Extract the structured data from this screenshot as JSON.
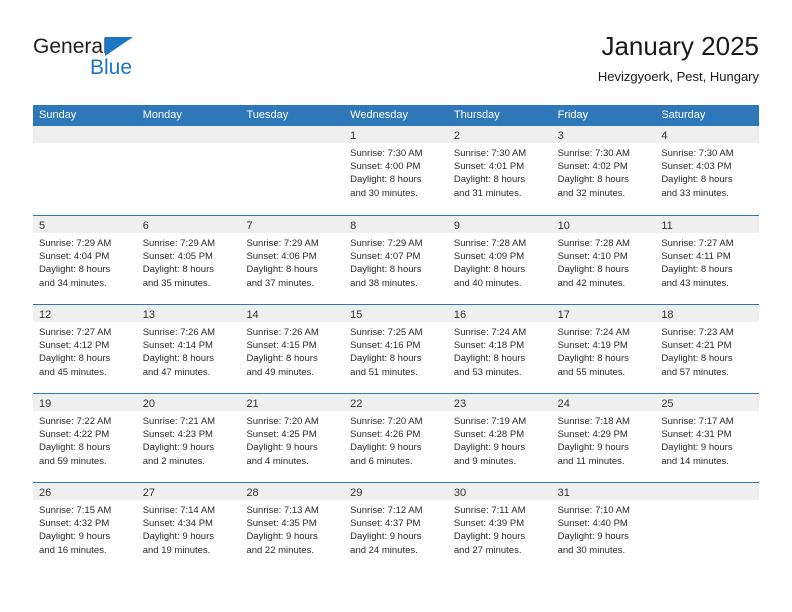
{
  "brand": {
    "line1": "General",
    "line2": "Blue",
    "triangle_color": "#1b77c4"
  },
  "header": {
    "title": "January 2025",
    "subtitle": "Hevizgyoerk, Pest, Hungary"
  },
  "theme": {
    "header_blue": "#2e77b8",
    "day_bar_gray": "#efefef",
    "text": "#2a2a2a"
  },
  "weekdays": [
    "Sunday",
    "Monday",
    "Tuesday",
    "Wednesday",
    "Thursday",
    "Friday",
    "Saturday"
  ],
  "weeks": [
    [
      {
        "day": "",
        "sunrise": "",
        "sunset": "",
        "daylight_line1": "",
        "daylight_line2": ""
      },
      {
        "day": "",
        "sunrise": "",
        "sunset": "",
        "daylight_line1": "",
        "daylight_line2": ""
      },
      {
        "day": "",
        "sunrise": "",
        "sunset": "",
        "daylight_line1": "",
        "daylight_line2": ""
      },
      {
        "day": "1",
        "sunrise": "Sunrise: 7:30 AM",
        "sunset": "Sunset: 4:00 PM",
        "daylight_line1": "Daylight: 8 hours",
        "daylight_line2": "and 30 minutes."
      },
      {
        "day": "2",
        "sunrise": "Sunrise: 7:30 AM",
        "sunset": "Sunset: 4:01 PM",
        "daylight_line1": "Daylight: 8 hours",
        "daylight_line2": "and 31 minutes."
      },
      {
        "day": "3",
        "sunrise": "Sunrise: 7:30 AM",
        "sunset": "Sunset: 4:02 PM",
        "daylight_line1": "Daylight: 8 hours",
        "daylight_line2": "and 32 minutes."
      },
      {
        "day": "4",
        "sunrise": "Sunrise: 7:30 AM",
        "sunset": "Sunset: 4:03 PM",
        "daylight_line1": "Daylight: 8 hours",
        "daylight_line2": "and 33 minutes."
      }
    ],
    [
      {
        "day": "5",
        "sunrise": "Sunrise: 7:29 AM",
        "sunset": "Sunset: 4:04 PM",
        "daylight_line1": "Daylight: 8 hours",
        "daylight_line2": "and 34 minutes."
      },
      {
        "day": "6",
        "sunrise": "Sunrise: 7:29 AM",
        "sunset": "Sunset: 4:05 PM",
        "daylight_line1": "Daylight: 8 hours",
        "daylight_line2": "and 35 minutes."
      },
      {
        "day": "7",
        "sunrise": "Sunrise: 7:29 AM",
        "sunset": "Sunset: 4:06 PM",
        "daylight_line1": "Daylight: 8 hours",
        "daylight_line2": "and 37 minutes."
      },
      {
        "day": "8",
        "sunrise": "Sunrise: 7:29 AM",
        "sunset": "Sunset: 4:07 PM",
        "daylight_line1": "Daylight: 8 hours",
        "daylight_line2": "and 38 minutes."
      },
      {
        "day": "9",
        "sunrise": "Sunrise: 7:28 AM",
        "sunset": "Sunset: 4:09 PM",
        "daylight_line1": "Daylight: 8 hours",
        "daylight_line2": "and 40 minutes."
      },
      {
        "day": "10",
        "sunrise": "Sunrise: 7:28 AM",
        "sunset": "Sunset: 4:10 PM",
        "daylight_line1": "Daylight: 8 hours",
        "daylight_line2": "and 42 minutes."
      },
      {
        "day": "11",
        "sunrise": "Sunrise: 7:27 AM",
        "sunset": "Sunset: 4:11 PM",
        "daylight_line1": "Daylight: 8 hours",
        "daylight_line2": "and 43 minutes."
      }
    ],
    [
      {
        "day": "12",
        "sunrise": "Sunrise: 7:27 AM",
        "sunset": "Sunset: 4:12 PM",
        "daylight_line1": "Daylight: 8 hours",
        "daylight_line2": "and 45 minutes."
      },
      {
        "day": "13",
        "sunrise": "Sunrise: 7:26 AM",
        "sunset": "Sunset: 4:14 PM",
        "daylight_line1": "Daylight: 8 hours",
        "daylight_line2": "and 47 minutes."
      },
      {
        "day": "14",
        "sunrise": "Sunrise: 7:26 AM",
        "sunset": "Sunset: 4:15 PM",
        "daylight_line1": "Daylight: 8 hours",
        "daylight_line2": "and 49 minutes."
      },
      {
        "day": "15",
        "sunrise": "Sunrise: 7:25 AM",
        "sunset": "Sunset: 4:16 PM",
        "daylight_line1": "Daylight: 8 hours",
        "daylight_line2": "and 51 minutes."
      },
      {
        "day": "16",
        "sunrise": "Sunrise: 7:24 AM",
        "sunset": "Sunset: 4:18 PM",
        "daylight_line1": "Daylight: 8 hours",
        "daylight_line2": "and 53 minutes."
      },
      {
        "day": "17",
        "sunrise": "Sunrise: 7:24 AM",
        "sunset": "Sunset: 4:19 PM",
        "daylight_line1": "Daylight: 8 hours",
        "daylight_line2": "and 55 minutes."
      },
      {
        "day": "18",
        "sunrise": "Sunrise: 7:23 AM",
        "sunset": "Sunset: 4:21 PM",
        "daylight_line1": "Daylight: 8 hours",
        "daylight_line2": "and 57 minutes."
      }
    ],
    [
      {
        "day": "19",
        "sunrise": "Sunrise: 7:22 AM",
        "sunset": "Sunset: 4:22 PM",
        "daylight_line1": "Daylight: 8 hours",
        "daylight_line2": "and 59 minutes."
      },
      {
        "day": "20",
        "sunrise": "Sunrise: 7:21 AM",
        "sunset": "Sunset: 4:23 PM",
        "daylight_line1": "Daylight: 9 hours",
        "daylight_line2": "and 2 minutes."
      },
      {
        "day": "21",
        "sunrise": "Sunrise: 7:20 AM",
        "sunset": "Sunset: 4:25 PM",
        "daylight_line1": "Daylight: 9 hours",
        "daylight_line2": "and 4 minutes."
      },
      {
        "day": "22",
        "sunrise": "Sunrise: 7:20 AM",
        "sunset": "Sunset: 4:26 PM",
        "daylight_line1": "Daylight: 9 hours",
        "daylight_line2": "and 6 minutes."
      },
      {
        "day": "23",
        "sunrise": "Sunrise: 7:19 AM",
        "sunset": "Sunset: 4:28 PM",
        "daylight_line1": "Daylight: 9 hours",
        "daylight_line2": "and 9 minutes."
      },
      {
        "day": "24",
        "sunrise": "Sunrise: 7:18 AM",
        "sunset": "Sunset: 4:29 PM",
        "daylight_line1": "Daylight: 9 hours",
        "daylight_line2": "and 11 minutes."
      },
      {
        "day": "25",
        "sunrise": "Sunrise: 7:17 AM",
        "sunset": "Sunset: 4:31 PM",
        "daylight_line1": "Daylight: 9 hours",
        "daylight_line2": "and 14 minutes."
      }
    ],
    [
      {
        "day": "26",
        "sunrise": "Sunrise: 7:15 AM",
        "sunset": "Sunset: 4:32 PM",
        "daylight_line1": "Daylight: 9 hours",
        "daylight_line2": "and 16 minutes."
      },
      {
        "day": "27",
        "sunrise": "Sunrise: 7:14 AM",
        "sunset": "Sunset: 4:34 PM",
        "daylight_line1": "Daylight: 9 hours",
        "daylight_line2": "and 19 minutes."
      },
      {
        "day": "28",
        "sunrise": "Sunrise: 7:13 AM",
        "sunset": "Sunset: 4:35 PM",
        "daylight_line1": "Daylight: 9 hours",
        "daylight_line2": "and 22 minutes."
      },
      {
        "day": "29",
        "sunrise": "Sunrise: 7:12 AM",
        "sunset": "Sunset: 4:37 PM",
        "daylight_line1": "Daylight: 9 hours",
        "daylight_line2": "and 24 minutes."
      },
      {
        "day": "30",
        "sunrise": "Sunrise: 7:11 AM",
        "sunset": "Sunset: 4:39 PM",
        "daylight_line1": "Daylight: 9 hours",
        "daylight_line2": "and 27 minutes."
      },
      {
        "day": "31",
        "sunrise": "Sunrise: 7:10 AM",
        "sunset": "Sunset: 4:40 PM",
        "daylight_line1": "Daylight: 9 hours",
        "daylight_line2": "and 30 minutes."
      },
      {
        "day": "",
        "sunrise": "",
        "sunset": "",
        "daylight_line1": "",
        "daylight_line2": ""
      }
    ]
  ]
}
